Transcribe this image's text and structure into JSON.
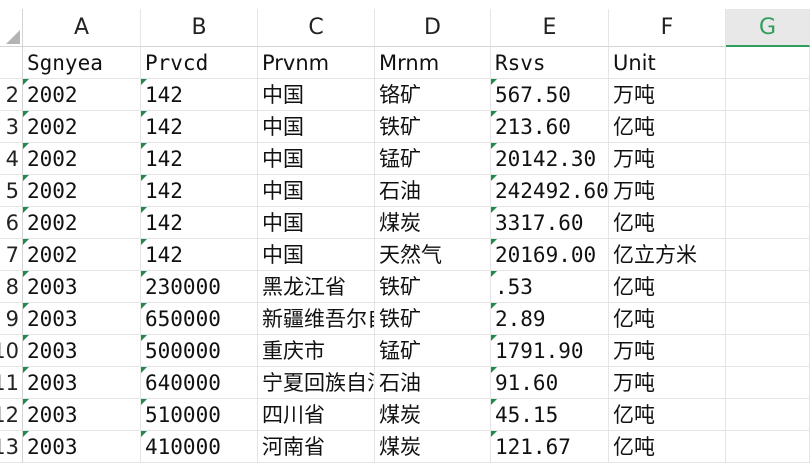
{
  "columns": [
    "A",
    "B",
    "C",
    "D",
    "E",
    "F",
    "G"
  ],
  "active_column": "G",
  "row_numbers": [
    "",
    "2",
    "3",
    "4",
    "5",
    "6",
    "7",
    "8",
    "9",
    "10",
    "11",
    "12",
    "13"
  ],
  "rows": [
    [
      "Sgnyea",
      "Prvcd",
      "Prvnm",
      "Mrnm",
      "Rsvs",
      "Unit"
    ],
    [
      "2002",
      "142",
      "中国",
      "铬矿",
      "567.50",
      "万吨"
    ],
    [
      "2002",
      "142",
      "中国",
      "铁矿",
      "213.60",
      "亿吨"
    ],
    [
      "2002",
      "142",
      "中国",
      "锰矿",
      "20142.30",
      "万吨"
    ],
    [
      "2002",
      "142",
      "中国",
      "石油",
      "242492.60",
      "万吨"
    ],
    [
      "2002",
      "142",
      "中国",
      "煤炭",
      "3317.60",
      "亿吨"
    ],
    [
      "2002",
      "142",
      "中国",
      "天然气",
      "20169.00",
      "亿立方米"
    ],
    [
      "2003",
      "230000",
      "黑龙江省",
      "铁矿",
      ".53",
      "亿吨"
    ],
    [
      "2003",
      "650000",
      "新疆维吾尔自治区",
      "铁矿",
      "2.89",
      "亿吨"
    ],
    [
      "2003",
      "500000",
      "重庆市",
      "锰矿",
      "1791.90",
      "万吨"
    ],
    [
      "2003",
      "640000",
      "宁夏回族自治区",
      "石油",
      "91.60",
      "万吨"
    ],
    [
      "2003",
      "510000",
      "四川省",
      "煤炭",
      "45.15",
      "亿吨"
    ],
    [
      "2003",
      "410000",
      "河南省",
      "煤炭",
      "121.67",
      "亿吨"
    ]
  ],
  "colors": {
    "accent": "#2e9e5a",
    "error_marker": "#1e8a4c"
  }
}
